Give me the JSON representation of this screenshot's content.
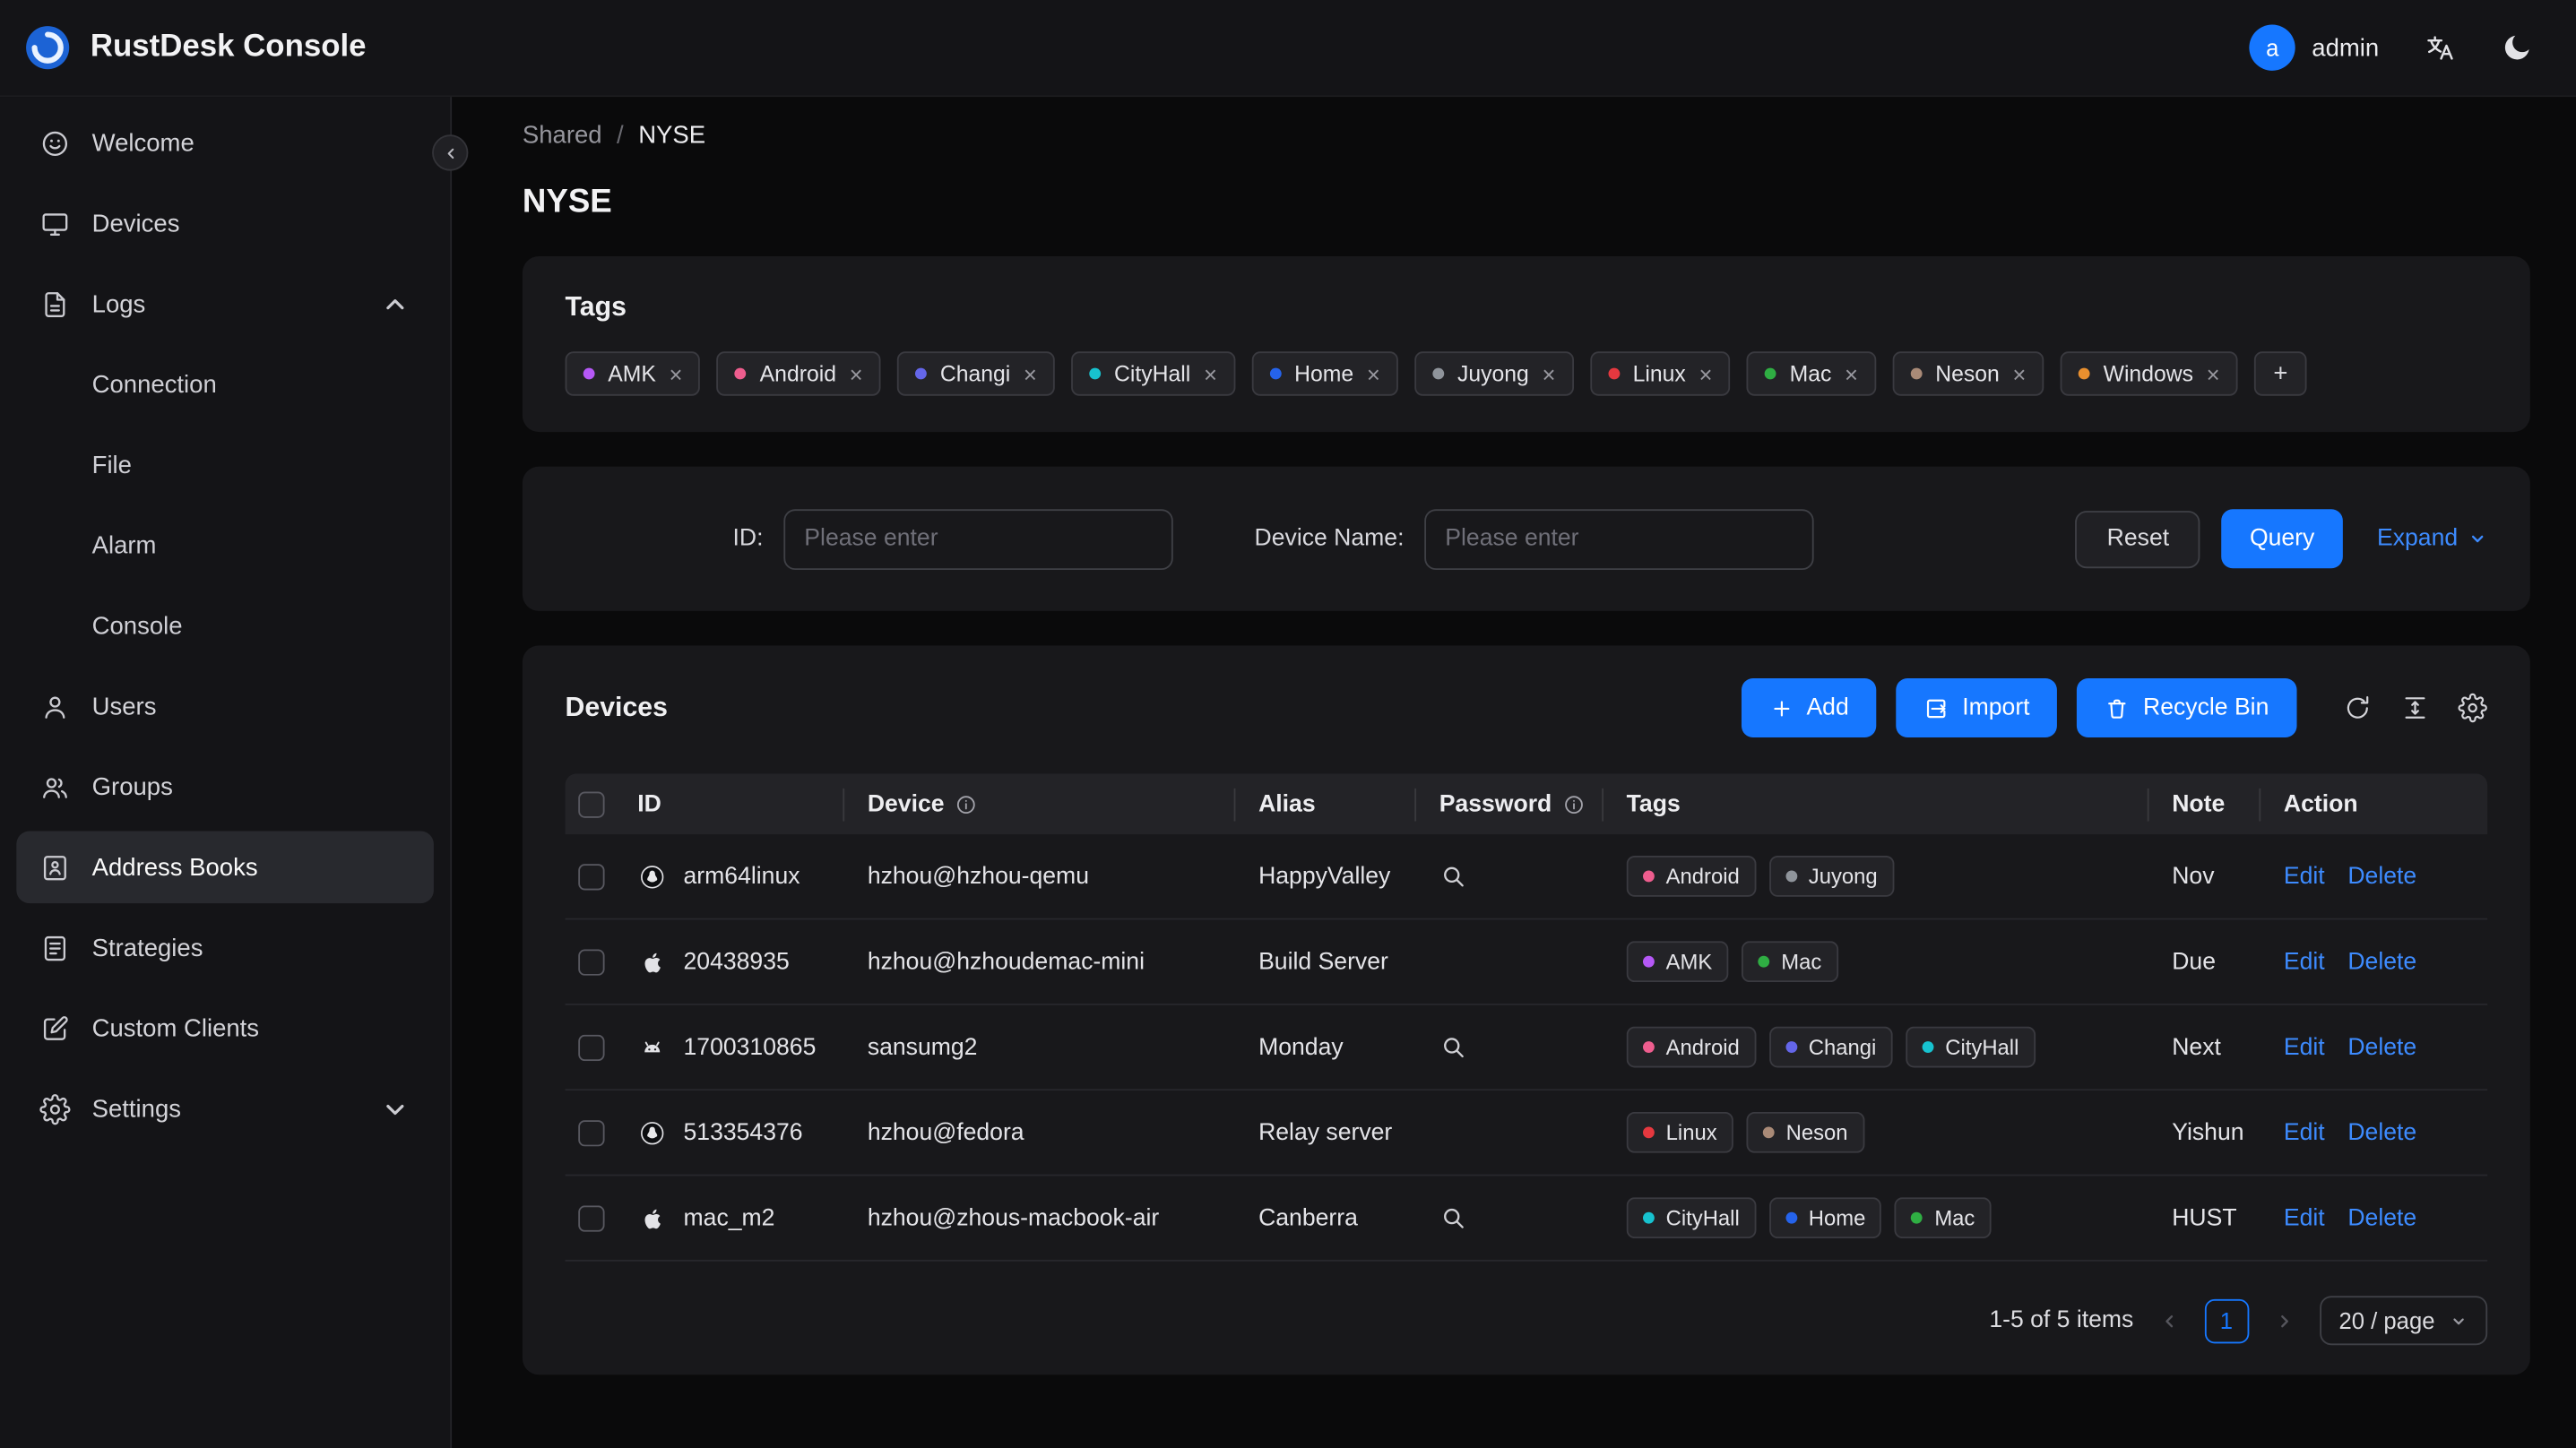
{
  "colors": {
    "accent": "#1677ff",
    "link": "#3d8bff"
  },
  "topbar": {
    "title": "RustDesk Console",
    "user": {
      "avatar_initial": "a",
      "name": "admin"
    }
  },
  "sidebar": {
    "items": [
      {
        "label": "Welcome"
      },
      {
        "label": "Devices"
      },
      {
        "label": "Logs"
      },
      {
        "label": "Users"
      },
      {
        "label": "Groups"
      },
      {
        "label": "Address Books"
      },
      {
        "label": "Strategies"
      },
      {
        "label": "Custom Clients"
      },
      {
        "label": "Settings"
      }
    ],
    "logs_children": [
      {
        "label": "Connection"
      },
      {
        "label": "File"
      },
      {
        "label": "Alarm"
      },
      {
        "label": "Console"
      }
    ]
  },
  "breadcrumb": {
    "parent": "Shared",
    "separator": "/",
    "current": "NYSE"
  },
  "page": {
    "title": "NYSE"
  },
  "tags_panel": {
    "title": "Tags",
    "add_button": "+",
    "close_glyph": "×",
    "tags": [
      {
        "label": "AMK",
        "color": "#b558f6"
      },
      {
        "label": "Android",
        "color": "#ee5d8e"
      },
      {
        "label": "Changi",
        "color": "#6466e9"
      },
      {
        "label": "CityHall",
        "color": "#17c2cf"
      },
      {
        "label": "Home",
        "color": "#2563eb"
      },
      {
        "label": "Juyong",
        "color": "#8f949b"
      },
      {
        "label": "Linux",
        "color": "#e5383f"
      },
      {
        "label": "Mac",
        "color": "#2fae43"
      },
      {
        "label": "Neson",
        "color": "#a98a77"
      },
      {
        "label": "Windows",
        "color": "#e98f2e"
      }
    ]
  },
  "filter_panel": {
    "id_label": "ID:",
    "id_placeholder": "Please enter",
    "device_name_label": "Device Name:",
    "device_name_placeholder": "Please enter",
    "reset_button": "Reset",
    "query_button": "Query",
    "expand_toggle": "Expand"
  },
  "devices_panel": {
    "title": "Devices",
    "buttons": {
      "add": "Add",
      "import": "Import",
      "recycle_bin": "Recycle Bin"
    },
    "columns": {
      "id": "ID",
      "device": "Device",
      "alias": "Alias",
      "password": "Password",
      "tags": "Tags",
      "note": "Note",
      "action": "Action"
    },
    "labels": {
      "edit": "Edit",
      "delete": "Delete"
    },
    "rows": [
      {
        "os": "linux",
        "id": "arm64linux",
        "device": "hzhou@hzhou-qemu",
        "alias": "HappyValley",
        "has_password": true,
        "tags": [
          {
            "label": "Android",
            "color": "#ee5d8e"
          },
          {
            "label": "Juyong",
            "color": "#8f949b"
          }
        ],
        "note": "Nov"
      },
      {
        "os": "apple",
        "id": "20438935",
        "device": "hzhou@hzhoudemac-mini",
        "alias": "Build Server",
        "has_password": false,
        "tags": [
          {
            "label": "AMK",
            "color": "#b558f6"
          },
          {
            "label": "Mac",
            "color": "#2fae43"
          }
        ],
        "note": "Due"
      },
      {
        "os": "android",
        "id": "1700310865",
        "device": "sansumg2",
        "alias": "Monday",
        "has_password": true,
        "tags": [
          {
            "label": "Android",
            "color": "#ee5d8e"
          },
          {
            "label": "Changi",
            "color": "#6466e9"
          },
          {
            "label": "CityHall",
            "color": "#17c2cf"
          }
        ],
        "note": "Next"
      },
      {
        "os": "linux",
        "id": "513354376",
        "device": "hzhou@fedora",
        "alias": "Relay server",
        "has_password": false,
        "tags": [
          {
            "label": "Linux",
            "color": "#e5383f"
          },
          {
            "label": "Neson",
            "color": "#a98a77"
          }
        ],
        "note": "Yishun"
      },
      {
        "os": "apple",
        "id": "mac_m2",
        "device": "hzhou@zhous-macbook-air",
        "alias": "Canberra",
        "has_password": true,
        "tags": [
          {
            "label": "CityHall",
            "color": "#17c2cf"
          },
          {
            "label": "Home",
            "color": "#2563eb"
          },
          {
            "label": "Mac",
            "color": "#2fae43"
          }
        ],
        "note": "HUST"
      }
    ],
    "pagination": {
      "summary": "1-5 of 5 items",
      "current_page": "1",
      "page_size": "20 / page"
    }
  }
}
